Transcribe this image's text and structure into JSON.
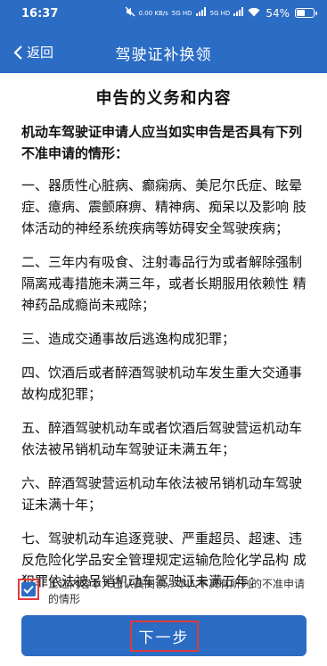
{
  "status_bar": {
    "time": "16:37",
    "net_speed": "0.00 KB/s",
    "signal1": "5G HD",
    "signal2": "5G HD",
    "battery_percent": "54%",
    "battery_level": 0.54
  },
  "header": {
    "back_label": "返回",
    "title": "驾驶证补换领"
  },
  "main": {
    "heading": "申告的义务和内容",
    "lead": "机动车驾驶证申请人应当如实申告是否具有下列不准申请的情形：",
    "items": [
      "一、器质性心脏病、癫痫病、美尼尔氏症、眩晕症、癔病、震颤麻痹、精神病、痴呆以及影响 肢体活动的神经系统疾病等妨碍安全驾驶疾病；",
      "二、三年内有吸食、注射毒品行为或者解除强制隔离戒毒措施未满三年，或者长期服用依赖性 精神药品成瘾尚未戒除；",
      "三、造成交通事故后逃逸构成犯罪；",
      "四、饮酒后或者醉酒驾驶机动车发生重大交通事故构成犯罪；",
      "五、醉酒驾驶机动车或者饮酒后驾驶营运机动车依法被吊销机动车驾驶证未满五年；",
      "六、醉酒驾驶营运机动车依法被吊销机动车驾驶证未满十年；",
      "七、驾驶机动车追逐竞驶、严重超员、超速、违反危险化学品安全管理规定运输危险化学品构 成犯罪依法被吊销机动车驾驶证未满五年；"
    ]
  },
  "agreement": {
    "checked": true,
    "text": "上述内容本人已认真阅读，本人不具有所列的不准申请的情形"
  },
  "footer": {
    "next_label": "下一步"
  },
  "colors": {
    "primary": "#2b6cc4",
    "highlight_border": "#e03a3a"
  }
}
